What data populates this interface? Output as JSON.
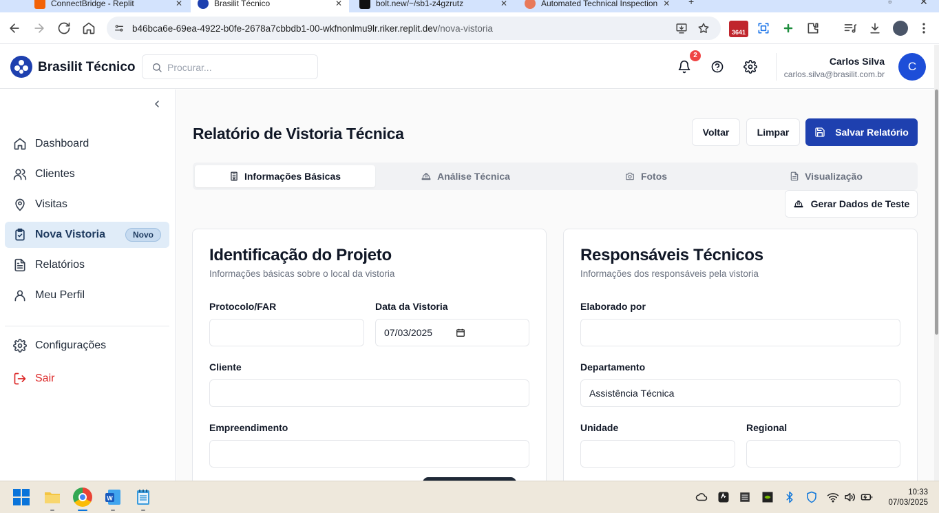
{
  "browser": {
    "tabs": [
      {
        "title": "ConnectBridge - Replit",
        "active": false
      },
      {
        "title": "Brasilit Técnico",
        "active": true
      },
      {
        "title": "bolt.new/~/sb1-z4gzrutz",
        "active": false
      },
      {
        "title": "Automated Technical Inspection",
        "active": false
      }
    ],
    "url_host": "b46bca6e-69ea-4922-b0fe-2678a7cbbdb1-00-wkfnonlmu9lr.riker.replit.dev",
    "url_path": "/nova-vistoria",
    "extension_badge": "3641"
  },
  "header": {
    "brand": "Brasilit Técnico",
    "search_placeholder": "Procurar...",
    "notification_count": "2",
    "user_name": "Carlos Silva",
    "user_email": "carlos.silva@brasilit.com.br",
    "avatar_initial": "C"
  },
  "sidebar": {
    "items": [
      {
        "label": "Dashboard",
        "icon": "home-icon"
      },
      {
        "label": "Clientes",
        "icon": "users-icon"
      },
      {
        "label": "Visitas",
        "icon": "map-pin-icon"
      },
      {
        "label": "Nova Vistoria",
        "icon": "clipboard-check-icon",
        "badge": "Novo",
        "active": true
      },
      {
        "label": "Relatórios",
        "icon": "file-text-icon"
      },
      {
        "label": "Meu Perfil",
        "icon": "user-icon"
      }
    ],
    "settings_label": "Configurações",
    "logout_label": "Sair"
  },
  "page": {
    "title": "Relatório de Vistoria Técnica",
    "back_label": "Voltar",
    "clear_label": "Limpar",
    "save_label": "Salvar Relatório",
    "tabs": [
      {
        "label": "Informações Básicas",
        "icon": "building-icon",
        "active": true
      },
      {
        "label": "Análise Técnica",
        "icon": "hard-hat-icon"
      },
      {
        "label": "Fotos",
        "icon": "camera-icon"
      },
      {
        "label": "Visualização",
        "icon": "file-text-icon"
      }
    ],
    "generate_test_label": "Gerar Dados de Teste"
  },
  "project_card": {
    "title": "Identificação do Projeto",
    "subtitle": "Informações básicas sobre o local da vistoria",
    "fields": {
      "protocolo": {
        "label": "Protocolo/FAR",
        "value": ""
      },
      "data": {
        "label": "Data da Vistoria",
        "value": "07/03/2025"
      },
      "cliente": {
        "label": "Cliente",
        "value": ""
      },
      "empreendimento": {
        "label": "Empreendimento",
        "value": ""
      }
    }
  },
  "responsible_card": {
    "title": "Responsáveis Técnicos",
    "subtitle": "Informações dos responsáveis pela vistoria",
    "fields": {
      "elaborado": {
        "label": "Elaborado por",
        "value": ""
      },
      "departamento": {
        "label": "Departamento",
        "value": "Assistência Técnica"
      },
      "unidade": {
        "label": "Unidade",
        "value": ""
      },
      "regional": {
        "label": "Regional",
        "value": ""
      }
    }
  },
  "taskbar": {
    "time": "10:33",
    "date": "07/03/2025"
  },
  "colors": {
    "primary": "#1e40af",
    "active_nav_bg": "#e0ecf8",
    "danger": "#dc2626",
    "badge_red": "#ef4444"
  }
}
